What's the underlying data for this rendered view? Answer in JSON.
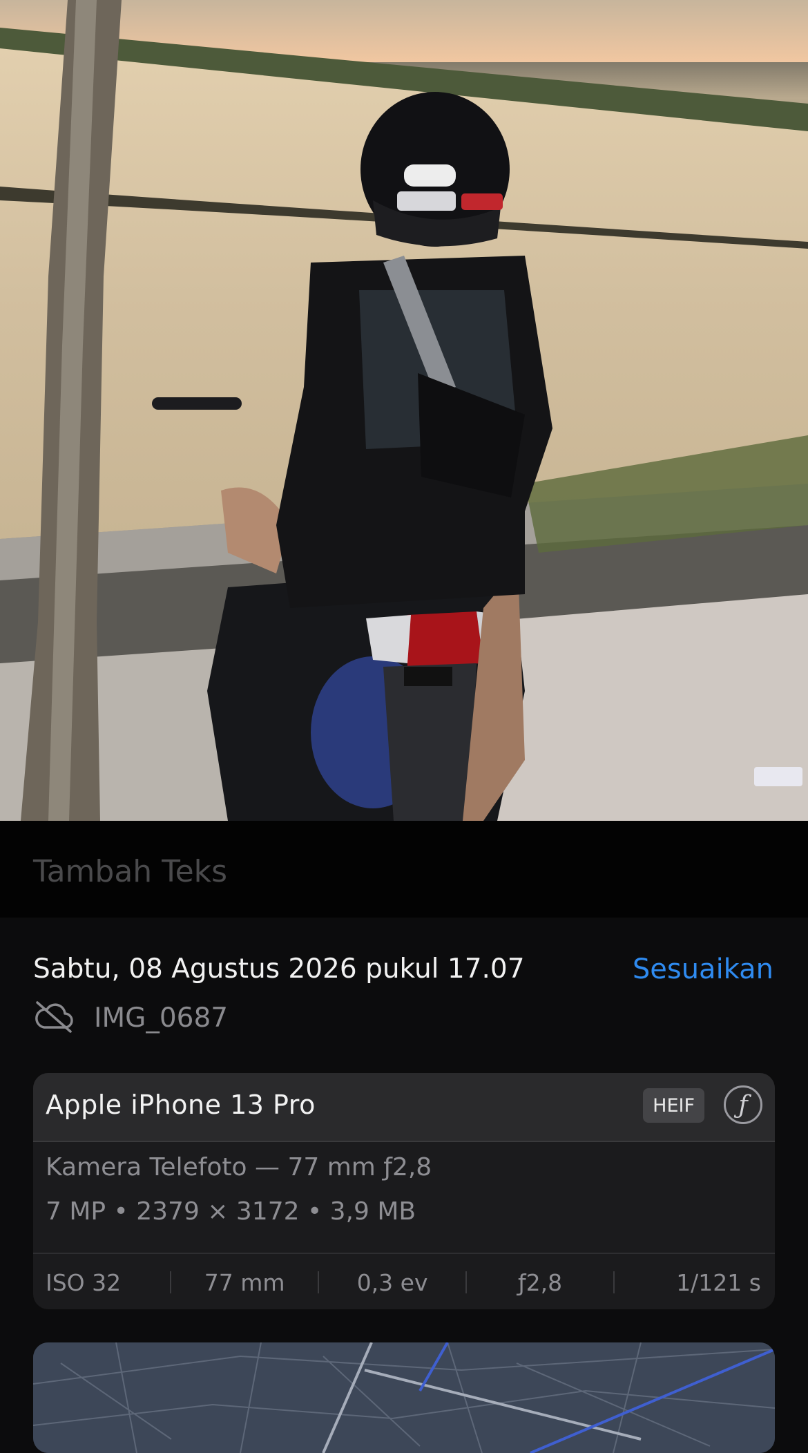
{
  "photo": {
    "alt_name": "motorcycle-rider-photo"
  },
  "caption": {
    "placeholder": "Tambah Teks"
  },
  "info": {
    "datetime": "Sabtu, 08 Agustus 2026 pukul 17.07",
    "adjust_label": "Sesuaikan",
    "filename": "IMG_0687",
    "cloud_icon": "cloud-off-icon"
  },
  "camera": {
    "device": "Apple iPhone 13 Pro",
    "format_badge": "HEIF",
    "f_badge": "ƒ",
    "lens": "Kamera Telefoto — 77 mm ƒ2,8",
    "specs": "7 MP • 2379 × 3172 • 3,9 MB",
    "exif": [
      "ISO 32",
      "77 mm",
      "0,3 ev",
      "ƒ2,8",
      "1/121 s"
    ]
  },
  "colors": {
    "accent": "#2f8bf0",
    "background": "#0c0c0d",
    "card": "#1b1b1d"
  }
}
